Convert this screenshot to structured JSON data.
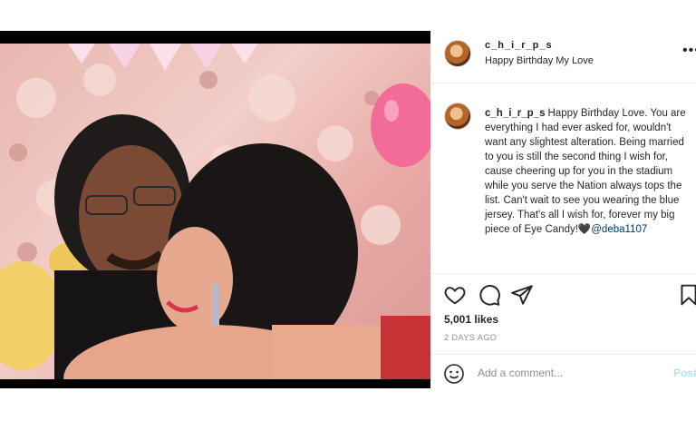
{
  "post": {
    "username": "c_h_i_r_p_s",
    "header_caption": "Happy Birthday My Love",
    "more_icon": "more-horizontal-icon",
    "caption_text": "Happy Birthday Love. You are everything I had ever asked for, wouldn't want any slightest alteration. Being married to you is still the second thing I wish for, cause cheering up for you in the stadium while you serve the Nation always tops the list. Can't wait to see you wearing the blue jersey. That's all I wish for, forever my big piece of Eye Candy!🖤",
    "mention": "@deba1107",
    "likes": "5,001 likes",
    "timestamp": "2 DAYS AGO"
  },
  "actions": {
    "like_icon": "heart-icon",
    "comment_icon": "comment-icon",
    "share_icon": "share-icon",
    "save_icon": "bookmark-icon"
  },
  "comment_bar": {
    "emoji_icon": "emoji-icon",
    "placeholder": "Add a comment...",
    "post_label": "Post"
  },
  "colors": {
    "link": "#00376b",
    "muted": "#8e8e8e",
    "post_disabled": "#b2dffc"
  }
}
